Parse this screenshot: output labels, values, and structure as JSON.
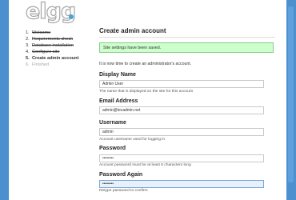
{
  "logo": {
    "text": "elgg"
  },
  "steps": [
    {
      "num": "1.",
      "label": "Welcome",
      "state": "done"
    },
    {
      "num": "2.",
      "label": "Requirements check",
      "state": "done"
    },
    {
      "num": "3.",
      "label": "Database installation",
      "state": "done"
    },
    {
      "num": "4.",
      "label": "Configure site",
      "state": "done"
    },
    {
      "num": "5.",
      "label": "Create admin account",
      "state": "current"
    },
    {
      "num": "6.",
      "label": "Finished",
      "state": "future"
    }
  ],
  "main": {
    "title": "Create admin account",
    "success_message": "Site settings have been saved.",
    "intro": "It is now time to create an administrator's account."
  },
  "form": {
    "display_name": {
      "label": "Display Name",
      "value": "Admin User",
      "help": "The name that is displayed on the site for this account"
    },
    "email": {
      "label": "Email Address",
      "value": "admin@tecadmin.net",
      "help": ""
    },
    "username": {
      "label": "Username",
      "value": "admin",
      "help": "Account username used for logging in"
    },
    "password": {
      "label": "Password",
      "value": "••••••••",
      "help": "Account password must be at least 6 characters long"
    },
    "password_again": {
      "label": "Password Again",
      "value": "••••••••",
      "help": "Retype password to confirm"
    }
  },
  "colors": {
    "background": "#4c90d0",
    "success_bg": "#ccffcc",
    "success_border": "#88cc88"
  }
}
